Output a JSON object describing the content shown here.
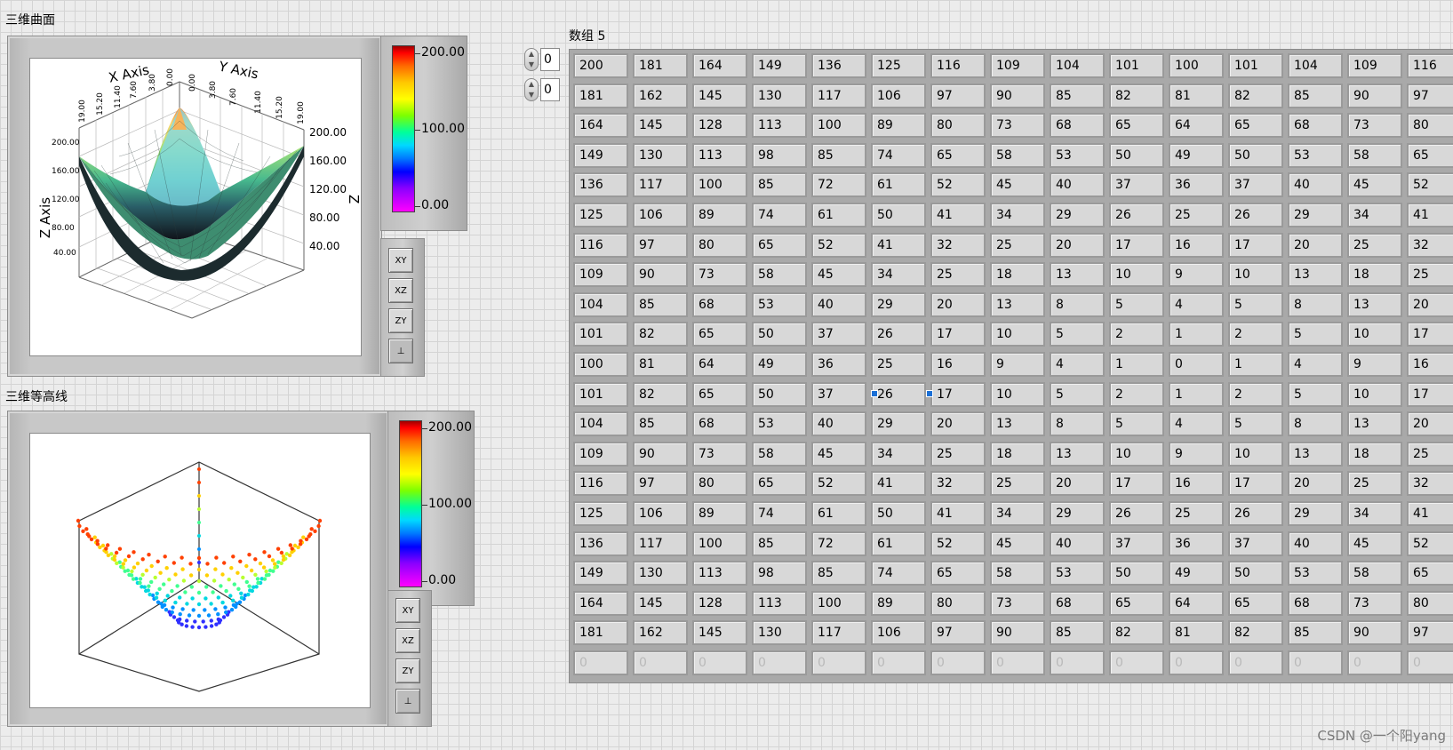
{
  "surface_graph": {
    "title": "三维曲面",
    "x_axis_label": "X Axis",
    "y_axis_label": "Y Axis",
    "z_axis_label": "Z Axis",
    "x_ticks": [
      "19.00",
      "15.20",
      "11.40",
      "7.60",
      "3.80",
      "0.00"
    ],
    "y_ticks": [
      "0.00",
      "3.80",
      "7.60",
      "11.40",
      "15.20",
      "19.00"
    ],
    "z_ticks": [
      "200.00",
      "160.00",
      "120.00",
      "80.00",
      "40.00"
    ],
    "z_ticks_right": [
      "200.00",
      "160.00",
      "120.00",
      "80.00",
      "40.00"
    ],
    "legend_ticks": [
      "200.00",
      "100.00",
      "0.00"
    ]
  },
  "contour_graph": {
    "title": "三维等高线",
    "legend_ticks": [
      "200.00",
      "100.00",
      "0.00"
    ]
  },
  "palette_buttons": [
    {
      "icon": "xy-plane-icon",
      "label": "XY"
    },
    {
      "icon": "xz-plane-icon",
      "label": "XZ"
    },
    {
      "icon": "yz-plane-icon",
      "label": "ZY"
    },
    {
      "icon": "default-view-icon",
      "label": "⊥"
    }
  ],
  "array": {
    "label": "数组 5",
    "row_index": "0",
    "col_index": "0",
    "rows": [
      [
        "200",
        "181",
        "164",
        "149",
        "136",
        "125",
        "116",
        "109",
        "104",
        "101",
        "100",
        "101",
        "104",
        "109",
        "116"
      ],
      [
        "181",
        "162",
        "145",
        "130",
        "117",
        "106",
        "97",
        "90",
        "85",
        "82",
        "81",
        "82",
        "85",
        "90",
        "97"
      ],
      [
        "164",
        "145",
        "128",
        "113",
        "100",
        "89",
        "80",
        "73",
        "68",
        "65",
        "64",
        "65",
        "68",
        "73",
        "80"
      ],
      [
        "149",
        "130",
        "113",
        "98",
        "85",
        "74",
        "65",
        "58",
        "53",
        "50",
        "49",
        "50",
        "53",
        "58",
        "65"
      ],
      [
        "136",
        "117",
        "100",
        "85",
        "72",
        "61",
        "52",
        "45",
        "40",
        "37",
        "36",
        "37",
        "40",
        "45",
        "52"
      ],
      [
        "125",
        "106",
        "89",
        "74",
        "61",
        "50",
        "41",
        "34",
        "29",
        "26",
        "25",
        "26",
        "29",
        "34",
        "41"
      ],
      [
        "116",
        "97",
        "80",
        "65",
        "52",
        "41",
        "32",
        "25",
        "20",
        "17",
        "16",
        "17",
        "20",
        "25",
        "32"
      ],
      [
        "109",
        "90",
        "73",
        "58",
        "45",
        "34",
        "25",
        "18",
        "13",
        "10",
        "9",
        "10",
        "13",
        "18",
        "25"
      ],
      [
        "104",
        "85",
        "68",
        "53",
        "40",
        "29",
        "20",
        "13",
        "8",
        "5",
        "4",
        "5",
        "8",
        "13",
        "20"
      ],
      [
        "101",
        "82",
        "65",
        "50",
        "37",
        "26",
        "17",
        "10",
        "5",
        "2",
        "1",
        "2",
        "5",
        "10",
        "17"
      ],
      [
        "100",
        "81",
        "64",
        "49",
        "36",
        "25",
        "16",
        "9",
        "4",
        "1",
        "0",
        "1",
        "4",
        "9",
        "16"
      ],
      [
        "101",
        "82",
        "65",
        "50",
        "37",
        "26",
        "17",
        "10",
        "5",
        "2",
        "1",
        "2",
        "5",
        "10",
        "17"
      ],
      [
        "104",
        "85",
        "68",
        "53",
        "40",
        "29",
        "20",
        "13",
        "8",
        "5",
        "4",
        "5",
        "8",
        "13",
        "20"
      ],
      [
        "109",
        "90",
        "73",
        "58",
        "45",
        "34",
        "25",
        "18",
        "13",
        "10",
        "9",
        "10",
        "13",
        "18",
        "25"
      ],
      [
        "116",
        "97",
        "80",
        "65",
        "52",
        "41",
        "32",
        "25",
        "20",
        "17",
        "16",
        "17",
        "20",
        "25",
        "32"
      ],
      [
        "125",
        "106",
        "89",
        "74",
        "61",
        "50",
        "41",
        "34",
        "29",
        "26",
        "25",
        "26",
        "29",
        "34",
        "41"
      ],
      [
        "136",
        "117",
        "100",
        "85",
        "72",
        "61",
        "52",
        "45",
        "40",
        "37",
        "36",
        "37",
        "40",
        "45",
        "52"
      ],
      [
        "149",
        "130",
        "113",
        "98",
        "85",
        "74",
        "65",
        "58",
        "53",
        "50",
        "49",
        "50",
        "53",
        "58",
        "65"
      ],
      [
        "164",
        "145",
        "128",
        "113",
        "100",
        "89",
        "80",
        "73",
        "68",
        "65",
        "64",
        "65",
        "68",
        "73",
        "80"
      ],
      [
        "181",
        "162",
        "145",
        "130",
        "117",
        "106",
        "97",
        "90",
        "85",
        "82",
        "81",
        "82",
        "85",
        "90",
        "97"
      ]
    ],
    "empty_row": [
      "0",
      "0",
      "0",
      "0",
      "0",
      "0",
      "0",
      "0",
      "0",
      "0",
      "0",
      "0",
      "0",
      "0",
      "0"
    ]
  },
  "watermark": "CSDN @一个阳yang"
}
